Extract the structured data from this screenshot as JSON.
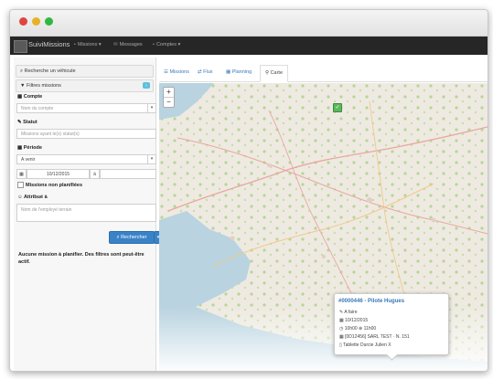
{
  "navbar": {
    "brand": "SuiviMissions",
    "items": [
      {
        "label": "Missions ▾",
        "icon": "briefcase-icon"
      },
      {
        "label": "Messages",
        "icon": "envelope-icon"
      },
      {
        "label": "Comptes ▾",
        "icon": "folder-icon"
      }
    ]
  },
  "sidebar": {
    "vehicle_search": "Recherche un véhicule",
    "filters_title": "Filtres missions",
    "filters_badge": "i",
    "account_label": "Compte",
    "account_placeholder": "Nom du compte",
    "status_label": "Statut",
    "status_placeholder": "Missions ayant le(s) statut(s)",
    "period_label": "Période",
    "period_value": "A venir",
    "date_value": "10/12/2015",
    "date_op": "à",
    "unplanned_label": "Missions non planifiées",
    "assigned_label": "Attribué à",
    "assigned_placeholder": "Nom de l'employé terrain",
    "search_button": "Rechercher",
    "info_text": "Aucune mission à planifier. Des filtres sont peut-être actif."
  },
  "tabs": [
    {
      "label": "Missions",
      "icon": "list-icon"
    },
    {
      "label": "Flux",
      "icon": "exchange-icon"
    },
    {
      "label": "Planning",
      "icon": "calendar-icon"
    },
    {
      "label": "Carte",
      "icon": "map-marker-icon"
    }
  ],
  "popup": {
    "mission_id": "#0000446",
    "title_sep": " - ",
    "title_name": "Pilote Hugues",
    "status": "A faire",
    "date": "10/12/2015",
    "time": "10h00 ⊕ 11h00",
    "ref": "[0D12456] SARL TEST · N. 151",
    "device": "Tablette Durcie Julien X"
  },
  "colors": {
    "accent": "#3a83c8",
    "navbar": "#262626",
    "pin": "#5cb85c"
  }
}
